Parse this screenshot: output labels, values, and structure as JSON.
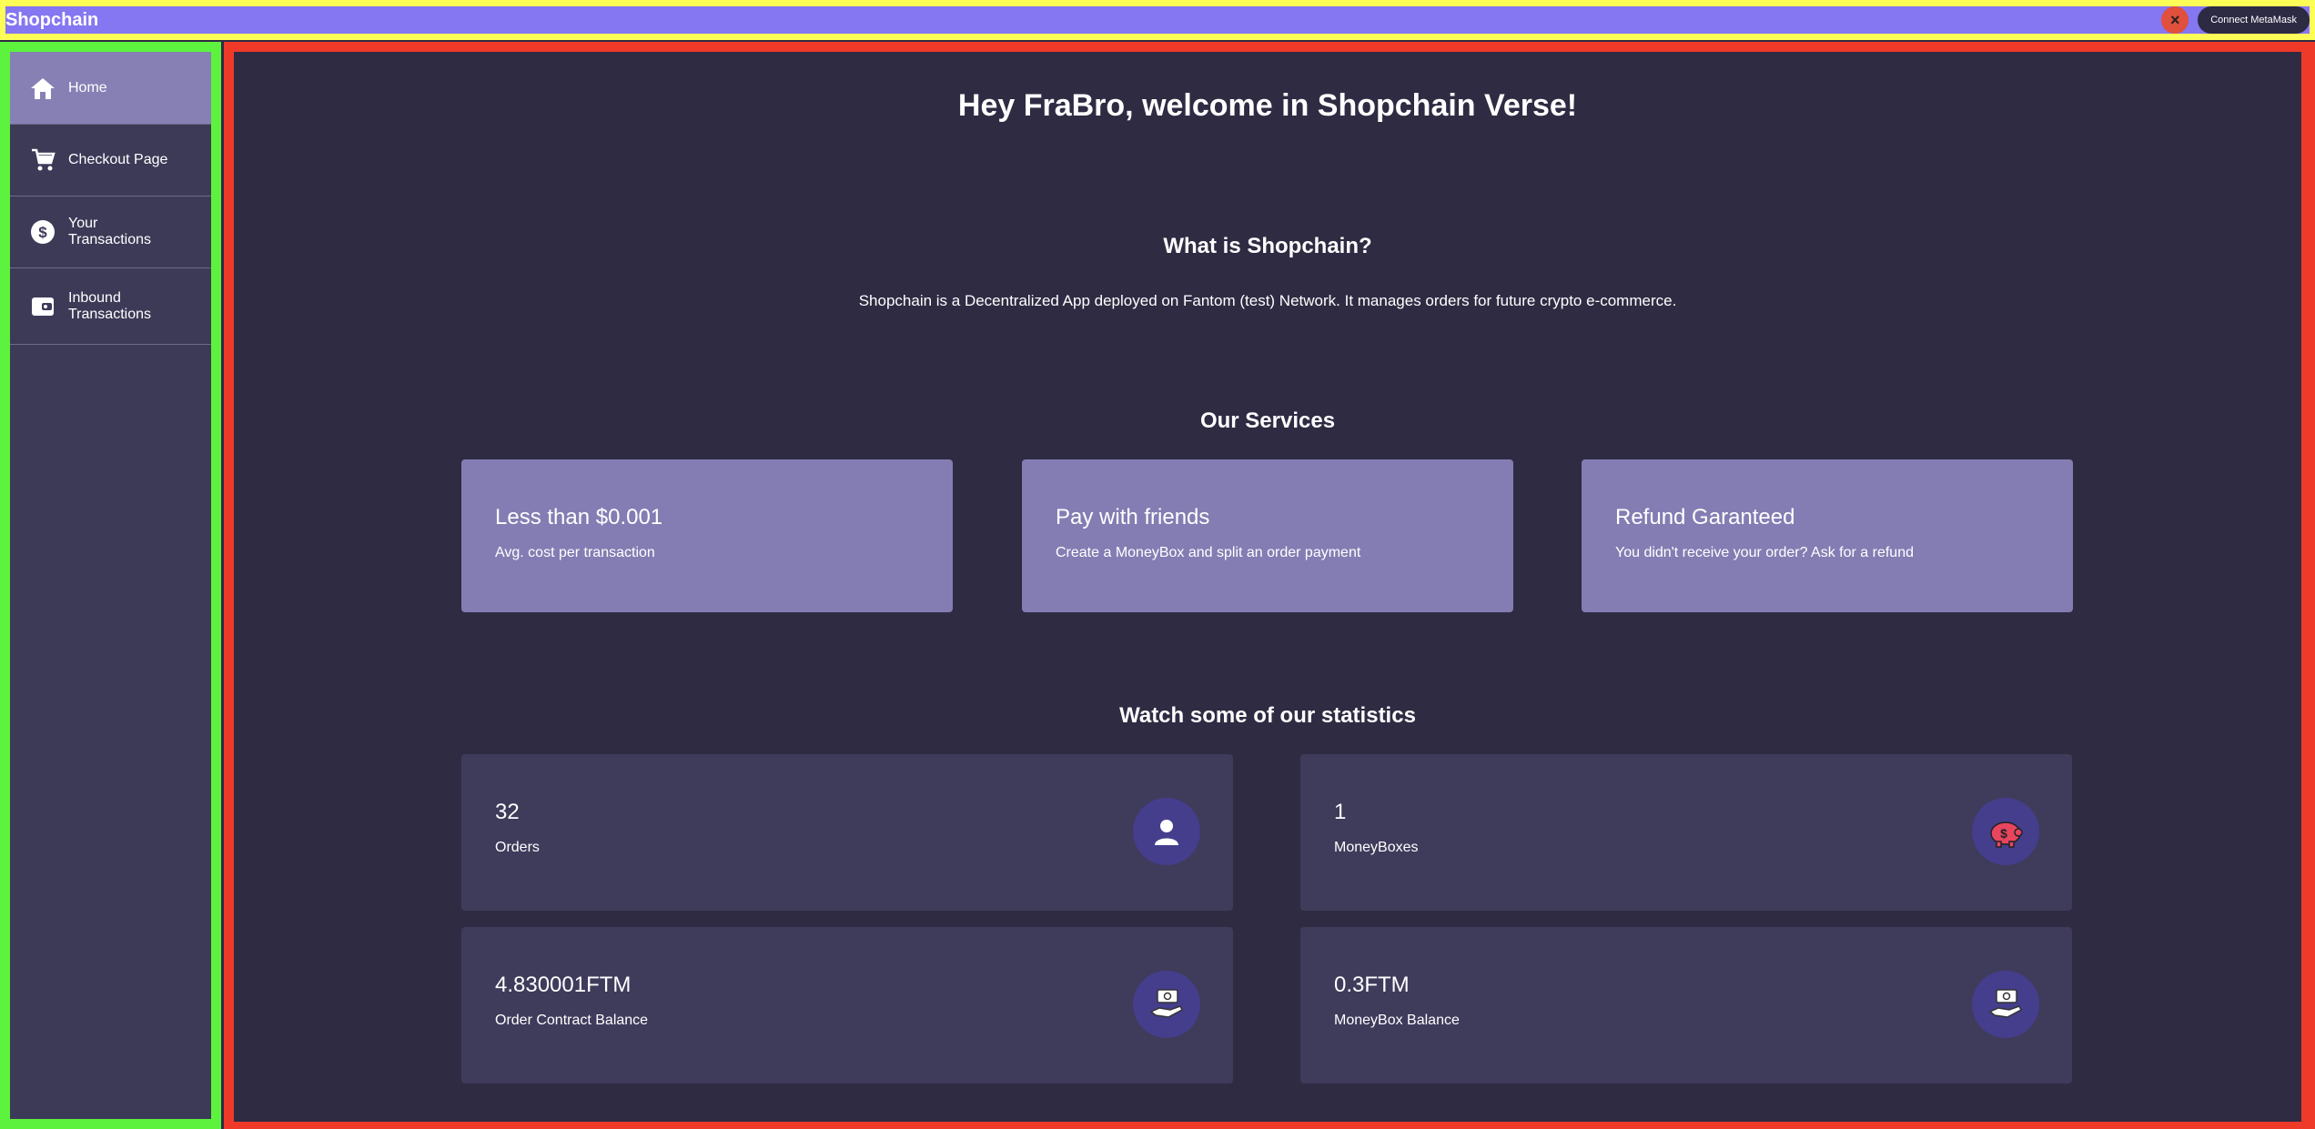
{
  "header": {
    "title": "Shopchain",
    "close_icon": "×",
    "connect_label": "Connect MetaMask"
  },
  "sidebar": {
    "items": [
      {
        "label": "Home",
        "icon": "home-icon"
      },
      {
        "label": "Checkout Page",
        "icon": "cart-icon"
      },
      {
        "label": "Your Transactions",
        "icon": "dollar-icon"
      },
      {
        "label": "Inbound Transactions",
        "icon": "wallet-icon"
      }
    ]
  },
  "main": {
    "welcome": "Hey FraBro, welcome in Shopchain Verse!",
    "what_title": "What is Shopchain?",
    "what_text": "Shopchain is a Decentralized App deployed on Fantom (test) Network. It manages orders for future crypto e-commerce.",
    "services_title": "Our Services",
    "services": [
      {
        "main": "Less than $0.001",
        "sub": "Avg. cost per transaction"
      },
      {
        "main": "Pay with friends",
        "sub": "Create a MoneyBox and split an order payment"
      },
      {
        "main": "Refund Garanteed",
        "sub": "You didn't receive your order? Ask for a refund"
      }
    ],
    "stats_title": "Watch some of our statistics",
    "stats": [
      {
        "value": "32",
        "label": "Orders",
        "icon": "user-icon"
      },
      {
        "value": "1",
        "label": "MoneyBoxes",
        "icon": "piggy-bank-icon"
      },
      {
        "value": "4.830001FTM",
        "label": "Order Contract Balance",
        "icon": "money-hand-icon"
      },
      {
        "value": "0.3FTM",
        "label": "MoneyBox Balance",
        "icon": "money-hand-icon"
      }
    ]
  },
  "colors": {
    "header": "#8576f2",
    "sidebar": "#3d3a58",
    "sidebar_active": "#8680b5",
    "main_bg": "#2f2b43",
    "service_card": "#847db3",
    "stat_card": "#3f3b5b",
    "stat_icon_bg": "#453e8d"
  }
}
